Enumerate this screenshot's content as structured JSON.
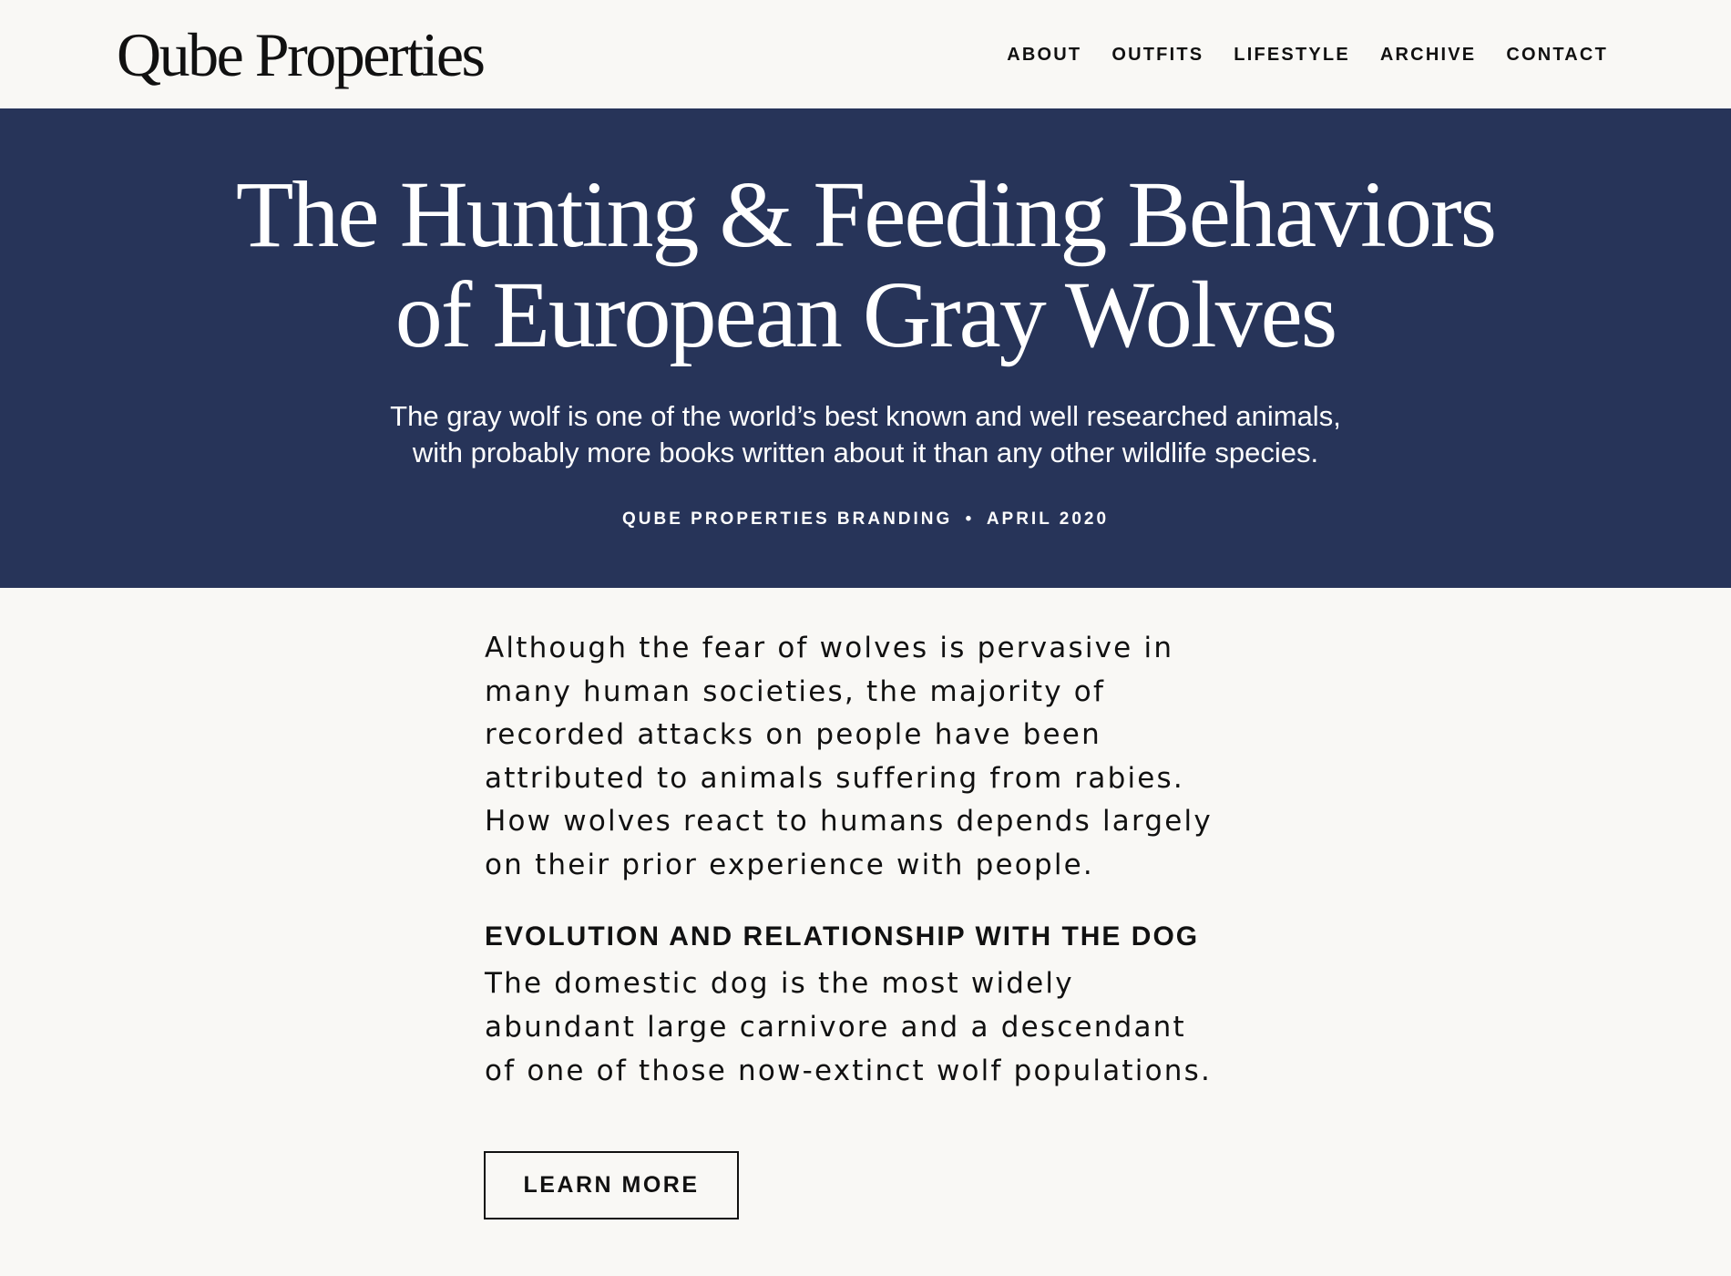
{
  "header": {
    "logo": "Qube Properties",
    "nav": [
      "ABOUT",
      "OUTFITS",
      "LIFESTYLE",
      "ARCHIVE",
      "CONTACT"
    ]
  },
  "hero": {
    "title_lines": [
      "The Hunting & Feeding Behaviors",
      "of European Gray Wolves"
    ],
    "subtitle_lines": [
      "The gray wolf is one of the world’s best known and well researched animals,",
      "with probably more books written about it than any other wildlife species."
    ],
    "meta": {
      "author": "QUBE PROPERTIES BRANDING",
      "separator": "•",
      "date": "APRIL 2020"
    },
    "background_color": "#273459"
  },
  "article": {
    "intro_lines": [
      "Although the fear of wolves is pervasive in",
      "many human societies, the majority of",
      "recorded attacks on people have been",
      "attributed to animals suffering from rabies.",
      "How wolves react to humans depends largely",
      "on their prior experience with people."
    ],
    "section_heading": "EVOLUTION AND RELATIONSHIP WITH THE DOG",
    "section_lines": [
      "The domestic dog is the most widely",
      "abundant large carnivore and a descendant",
      "of one of those now-extinct wolf populations."
    ],
    "cta_label": "LEARN MORE"
  },
  "colors": {
    "page_background": "#f9f8f5",
    "text": "#111111",
    "hero_text": "#ffffff"
  }
}
